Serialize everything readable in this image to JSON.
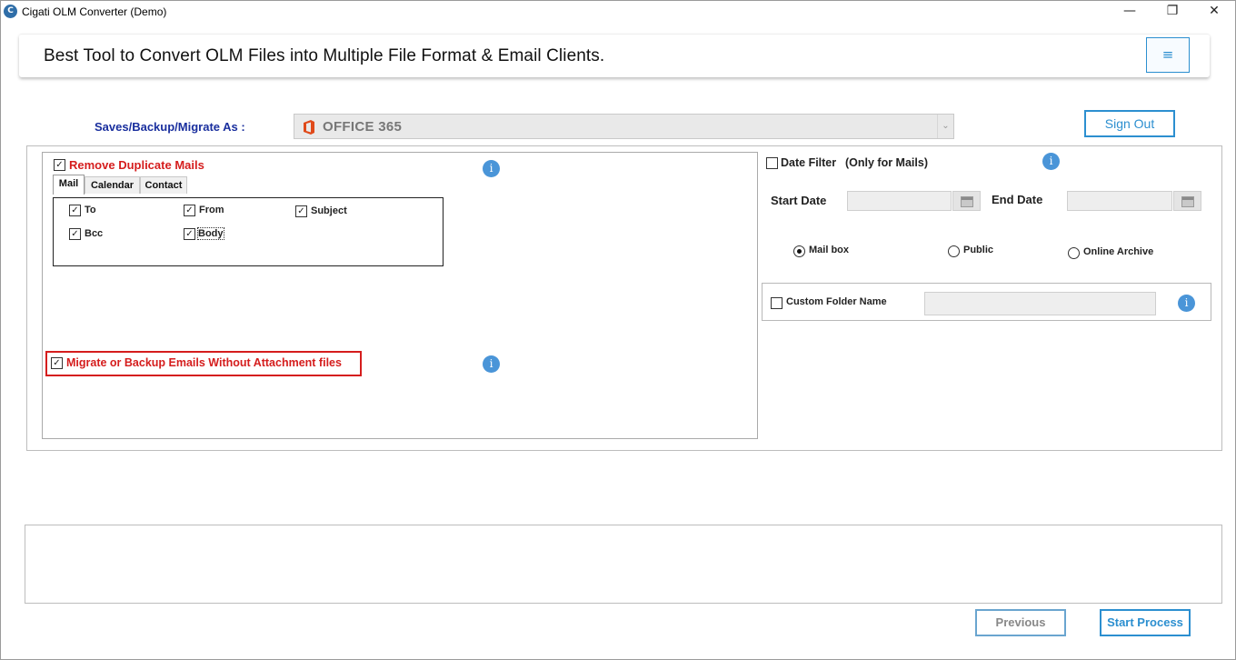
{
  "window": {
    "title": "Cigati OLM Converter (Demo)",
    "minimize_glyph": "—",
    "maximize_glyph": "❐",
    "close_glyph": "✕"
  },
  "banner": {
    "title": "Best Tool to Convert OLM Files into Multiple File Format & Email Clients.",
    "menu_glyph": "≡"
  },
  "saves": {
    "label": "Saves/Backup/Migrate As :",
    "selected": "OFFICE 365",
    "arrow_glyph": "⌄"
  },
  "sign_out_label": "Sign Out",
  "duplicate": {
    "label": "Remove Duplicate Mails",
    "checked": true,
    "tabs": [
      {
        "label": "Mail",
        "active": true
      },
      {
        "label": "Calendar",
        "active": false
      },
      {
        "label": "Contact",
        "active": false
      }
    ],
    "fields": [
      {
        "label": "To",
        "checked": true
      },
      {
        "label": "From",
        "checked": true
      },
      {
        "label": "Subject",
        "checked": true
      },
      {
        "label": "Bcc",
        "checked": true
      },
      {
        "label": "Body",
        "checked": true
      }
    ]
  },
  "migrate_without_attachments": {
    "label": "Migrate or Backup Emails Without Attachment files",
    "checked": true
  },
  "date_filter": {
    "label": "Date Filter",
    "note": "(Only for Mails)",
    "checked": false,
    "start_label": "Start Date",
    "end_label": "End Date",
    "start_value": "",
    "end_value": ""
  },
  "folder_scope": {
    "options": [
      {
        "label": "Mail box",
        "selected": true
      },
      {
        "label": "Public",
        "selected": false
      },
      {
        "label": "Online Archive",
        "selected": false
      }
    ]
  },
  "custom_folder": {
    "label": "Custom Folder Name",
    "checked": false,
    "value": ""
  },
  "info_glyph": "i",
  "check_glyph": "✓",
  "footer": {
    "previous_label": "Previous",
    "start_label": "Start Process"
  },
  "colors": {
    "accent": "#2c8fd0",
    "warning_red": "#d51d1d",
    "label_blue": "#1a2f9e",
    "office_orange": "#e04a1a"
  }
}
